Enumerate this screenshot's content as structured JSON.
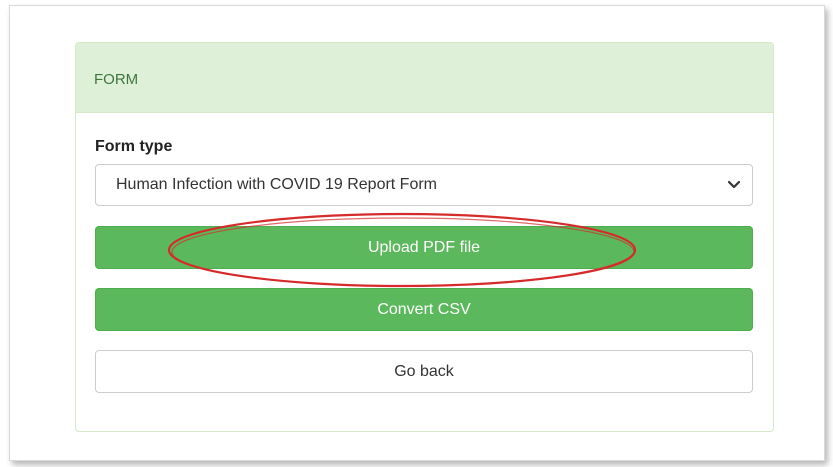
{
  "panel": {
    "heading": "FORM"
  },
  "form": {
    "label": "Form type",
    "selected_option": "Human Infection with COVID 19 Report Form"
  },
  "buttons": {
    "upload": "Upload PDF file",
    "convert": "Convert CSV",
    "back": "Go back"
  },
  "colors": {
    "success": "#5cb85c",
    "panel_heading_bg": "#dff0d8",
    "panel_heading_text": "#3c763d",
    "annotation": "#d62b2b"
  },
  "icons": {
    "select_arrow": "chevron-down-icon"
  }
}
